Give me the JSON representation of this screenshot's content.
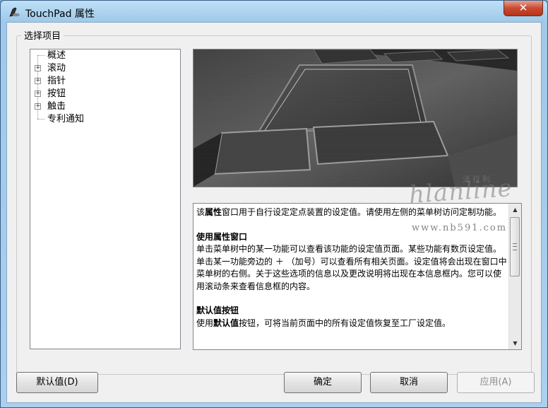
{
  "window": {
    "title": "TouchPad 属性",
    "close_label": "✕"
  },
  "group": {
    "label": "选择项目"
  },
  "tree": {
    "items": [
      {
        "label": "概述",
        "expandable": false
      },
      {
        "label": "滚动",
        "expandable": true
      },
      {
        "label": "指针",
        "expandable": true
      },
      {
        "label": "按钮",
        "expandable": true
      },
      {
        "label": "触击",
        "expandable": true
      },
      {
        "label": "专利通知",
        "expandable": false
      }
    ],
    "expander_glyph": "+"
  },
  "info": {
    "para1_prefix": "该",
    "para1_bold": "属性",
    "para1_rest": "窗口用于自行设定定点装置的设定值。请使用左侧的菜单树访问定制功能。",
    "h2": "使用属性窗口",
    "para2": "单击菜单树中的某一功能可以查看该功能的设定值页面。某些功能有数页设定值。单击某一功能旁边的 ＋ （加号）可以查看所有相关页面。设定值将会出现在窗口中菜单树的右侧。关于这些选项的信息以及更改说明将出现在本信息框内。您可以使用滚动条来查看信息框的内容。",
    "h3": "默认值按钮",
    "para3_prefix": "使用",
    "para3_bold": "默认值",
    "para3_rest": "按钮，可将当前页面中的所有设定值恢复至工厂设定值。"
  },
  "buttons": {
    "default": "默认值(D)",
    "ok": "确定",
    "cancel": "取消",
    "apply": "应用(A)"
  },
  "watermark": {
    "top_text": "法拉利",
    "main_text": "hlanline",
    "url": "www.nb591.com"
  },
  "scrollbar": {
    "up_arrow": "▲",
    "down_arrow": "▼"
  }
}
